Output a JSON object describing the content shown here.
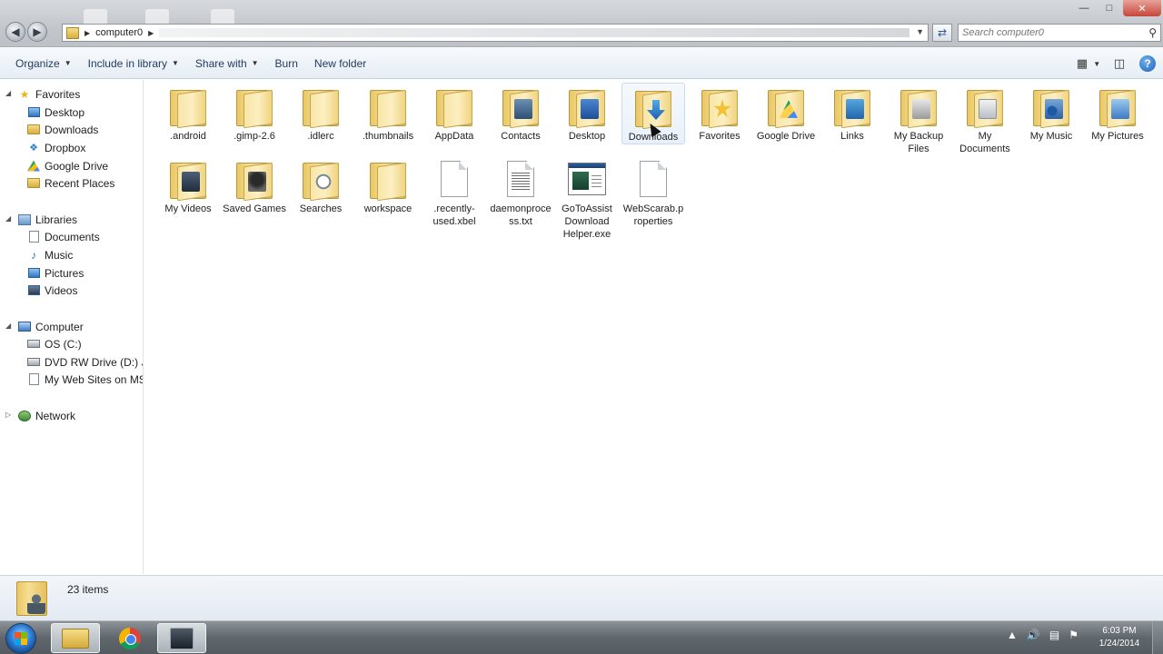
{
  "address_bar": {
    "path": [
      "computer0"
    ],
    "search_placeholder": "Search computer0"
  },
  "toolbar": {
    "organize": "Organize",
    "include_in_library": "Include in library",
    "share_with": "Share with",
    "burn": "Burn",
    "new_folder": "New folder"
  },
  "nav": {
    "favorites": {
      "label": "Favorites",
      "items": [
        {
          "label": "Desktop",
          "icon": "desktop-icon"
        },
        {
          "label": "Downloads",
          "icon": "downloads-icon"
        },
        {
          "label": "Dropbox",
          "icon": "dropbox-icon"
        },
        {
          "label": "Google Drive",
          "icon": "google-drive-icon"
        },
        {
          "label": "Recent Places",
          "icon": "recent-places-icon"
        }
      ]
    },
    "libraries": {
      "label": "Libraries",
      "items": [
        {
          "label": "Documents",
          "icon": "documents-icon"
        },
        {
          "label": "Music",
          "icon": "music-icon"
        },
        {
          "label": "Pictures",
          "icon": "pictures-icon"
        },
        {
          "label": "Videos",
          "icon": "videos-icon"
        }
      ]
    },
    "computer": {
      "label": "Computer",
      "items": [
        {
          "label": "OS (C:)",
          "icon": "drive-icon"
        },
        {
          "label": "DVD RW Drive (D:) Jan",
          "icon": "dvd-drive-icon"
        },
        {
          "label": "My Web Sites on MSN",
          "icon": "web-sites-icon"
        }
      ]
    },
    "network": {
      "label": "Network"
    }
  },
  "items": [
    {
      "label": ".android",
      "kind": "folder"
    },
    {
      "label": ".gimp-2.6",
      "kind": "folder"
    },
    {
      "label": ".idlerc",
      "kind": "folder"
    },
    {
      "label": ".thumbnails",
      "kind": "folder"
    },
    {
      "label": "AppData",
      "kind": "folder"
    },
    {
      "label": "Contacts",
      "kind": "folder"
    },
    {
      "label": "Desktop",
      "kind": "folder"
    },
    {
      "label": "Downloads",
      "kind": "folder"
    },
    {
      "label": "Favorites",
      "kind": "folder"
    },
    {
      "label": "Google Drive",
      "kind": "folder"
    },
    {
      "label": "Links",
      "kind": "folder"
    },
    {
      "label": "My Backup Files",
      "kind": "folder"
    },
    {
      "label": "My Documents",
      "kind": "folder"
    },
    {
      "label": "My Music",
      "kind": "folder"
    },
    {
      "label": "My Pictures",
      "kind": "folder"
    },
    {
      "label": "My Videos",
      "kind": "folder"
    },
    {
      "label": "Saved Games",
      "kind": "folder"
    },
    {
      "label": "Searches",
      "kind": "folder"
    },
    {
      "label": "workspace",
      "kind": "folder"
    },
    {
      "label": ".recently-used.xbel",
      "kind": "file"
    },
    {
      "label": "daemonprocess.txt",
      "kind": "text-file"
    },
    {
      "label": "GoToAssist Download Helper.exe",
      "kind": "exe"
    },
    {
      "label": "WebScarab.properties",
      "kind": "file"
    }
  ],
  "details": {
    "item_count": "23 items"
  },
  "taskbar": {
    "clock_time": "6:03 PM",
    "clock_date": "1/24/2014"
  }
}
